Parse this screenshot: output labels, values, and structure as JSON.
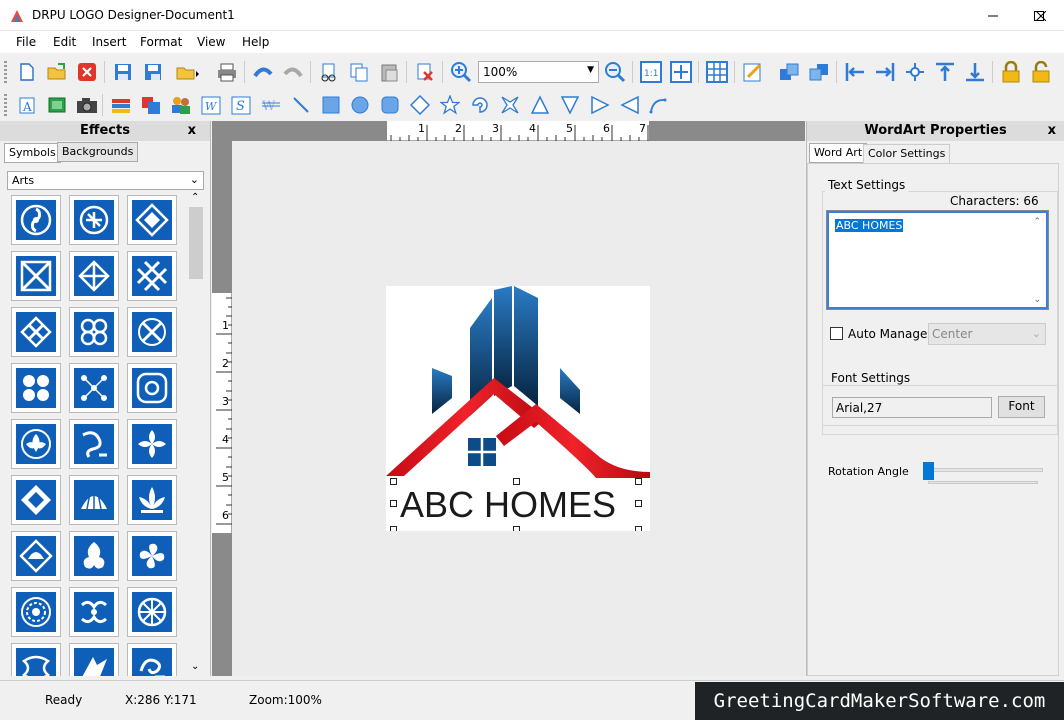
{
  "window": {
    "title": "DRPU LOGO Designer-Document1"
  },
  "menu": [
    "File",
    "Edit",
    "Insert",
    "Format",
    "View",
    "Help"
  ],
  "toolbar": {
    "zoom_value": "100%"
  },
  "effects_panel": {
    "title": "Effects",
    "close": "x",
    "tabs": [
      "Symbols",
      "Backgrounds"
    ],
    "category": "Arts"
  },
  "canvas": {
    "ruler_h_labels": [
      "1",
      "2",
      "3",
      "4",
      "5",
      "6",
      "7"
    ],
    "ruler_v_labels": [
      "1",
      "2",
      "3",
      "4",
      "5",
      "6"
    ],
    "logo_text": "ABC HOMES",
    "colors": {
      "building": "#0d4c86",
      "roof": "#e0141c",
      "text": "#1a1a1a"
    }
  },
  "wordart_panel": {
    "title": "WordArt Properties",
    "close": "x",
    "tabs": [
      "Word Art",
      "Color Settings"
    ],
    "text_settings": {
      "label": "Text Settings",
      "characters": "Characters: 66",
      "text": "ABC HOMES"
    },
    "auto_manage_label": "Auto Manage",
    "align_value": "Center",
    "font_settings": {
      "label": "Font Settings",
      "font_value": "Arial,27",
      "font_button": "Font"
    },
    "rotation_label": "Rotation Angle"
  },
  "status": {
    "ready": "Ready",
    "coords": "X:286  Y:171",
    "zoom": "Zoom:100%"
  },
  "watermark": "GreetingCardMakerSoftware.com"
}
